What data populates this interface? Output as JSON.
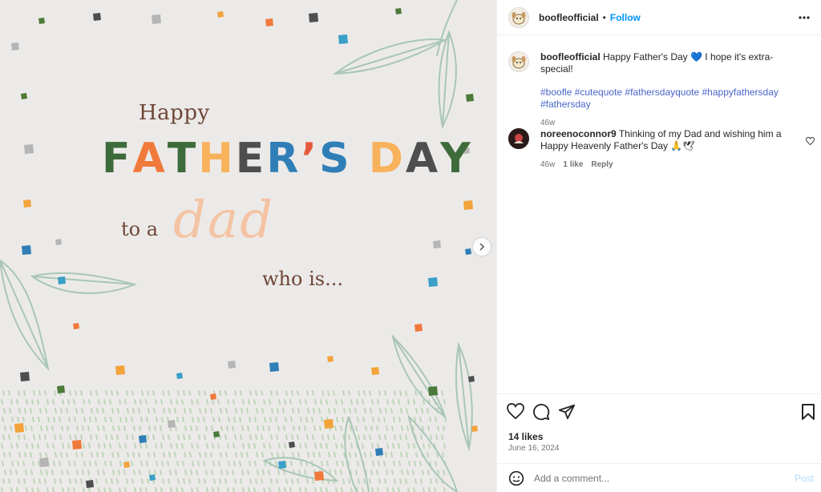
{
  "image": {
    "line_happy": "Happy",
    "line_fathers_day_letters": [
      "F",
      "A",
      "T",
      "H",
      "E",
      "R",
      "’",
      "S",
      " ",
      "D",
      "A",
      "Y"
    ],
    "line_to_a": "to a",
    "line_dad": "dad",
    "line_who_is": "who is...",
    "colors": {
      "letters": [
        "#3d6b3a",
        "#f07a3c",
        "#3d6b3a",
        "#f9b25c",
        "#4e4e4e",
        "#2f7eb8",
        "#e65a3c",
        "#2f7eb8",
        "#ffffff",
        "#f9b25c",
        "#4e4e4e",
        "#3d6b3a"
      ],
      "brown": "#6e4638",
      "dad": "#f4c3a3",
      "background": "#eceae8"
    }
  },
  "header": {
    "username": "boofleofficial",
    "separator": "•",
    "follow_label": "Follow"
  },
  "caption": {
    "username": "boofleofficial",
    "text": "Happy Father's Day 💙  I hope it's extra-special!",
    "hashtags": "#boofle #cutequote #fathersdayquote #happyfathersday #fathersday",
    "time": "46w"
  },
  "comments": [
    {
      "username": "noreenoconnor9",
      "text": "Thinking of my Dad and wishing him a Happy Heavenly Father's Day 🙏🕊",
      "time": "46w",
      "likes": "1 like",
      "reply_label": "Reply"
    }
  ],
  "stats": {
    "likes": "14 likes",
    "date": "June 16, 2024"
  },
  "add_comment": {
    "placeholder": "Add a comment...",
    "post_label": "Post"
  },
  "icons": {
    "more": "more-options-icon",
    "like": "heart-icon",
    "comment": "comment-icon",
    "share": "share-icon",
    "save": "bookmark-icon",
    "emoji": "emoji-icon",
    "next": "chevron-right-icon"
  },
  "accent_colors": {
    "follow": "#0095f6",
    "hashtag": "#4a64c8",
    "muted": "#737373"
  }
}
